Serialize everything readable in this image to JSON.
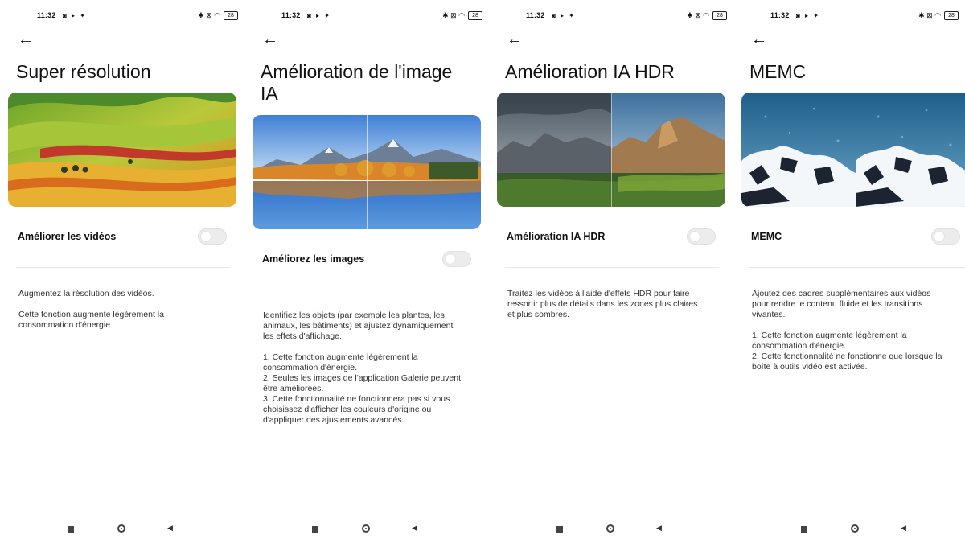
{
  "status": {
    "time": "11:32",
    "battery": "28",
    "left_icons": "◙ ▸ ✦",
    "right_icons": "✱ ⊠ ◠"
  },
  "back_symbol": "←",
  "panels": [
    {
      "title": "Super résolution",
      "toggle_label": "Améliorer les vidéos",
      "toggle_on": false,
      "paragraphs": [
        "Augmentez la résolution des vidéos.",
        "Cette fonction augmente légèrement la\nconsommation d'énergie."
      ]
    },
    {
      "title": "Amélioration de l'image\nIA",
      "toggle_label": "Améliorez les images",
      "toggle_on": false,
      "paragraphs": [
        "Identifiez les objets (par exemple les plantes, les\nanimaux, les bâtiments) et ajustez dynamiquement\nles effets d'affichage.",
        "1. Cette fonction augmente légèrement la\nconsommation d'énergie.\n2. Seules les images de l'application Galerie peuvent\nêtre améliorées.\n3. Cette fonctionnalité ne fonctionnera pas si vous\nchoisissez d'afficher les couleurs d'origine ou\nd'appliquer des ajustements avancés."
      ]
    },
    {
      "title": "Amélioration IA HDR",
      "toggle_label": "Amélioration IA HDR",
      "toggle_on": false,
      "paragraphs": [
        "Traitez les vidéos à l'aide d'effets HDR pour faire\nressortir plus de détails dans les zones plus claires\net plus sombres."
      ]
    },
    {
      "title": "MEMC",
      "toggle_label": "MEMC",
      "toggle_on": false,
      "paragraphs": [
        "Ajoutez des cadres supplémentaires aux vidéos\npour rendre le contenu fluide et les transitions\nvivantes.",
        "1. Cette fonction augmente légèrement la\nconsommation d'énergie.\n2. Cette fonctionnalité ne fonctionne que lorsque la\nboîte à outils vidéo est activée."
      ]
    }
  ],
  "nav": {
    "back_symbol": "◀"
  }
}
